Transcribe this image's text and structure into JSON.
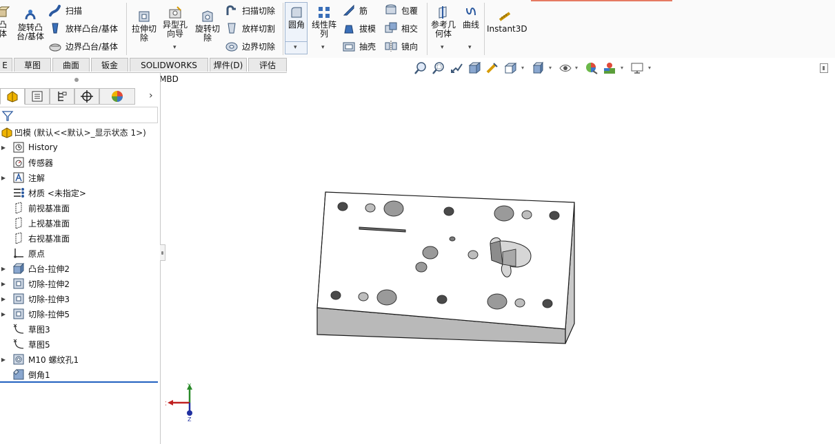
{
  "ribbon": {
    "features": {
      "extrude_boss": "凸\n体",
      "revolve_boss": "旋转凸\n台/基体",
      "sweep": "扫描",
      "loft": "放样凸台/基体",
      "boundary": "边界凸台/基体",
      "extrude_cut": "拉伸切\n除",
      "hole_wizard": "异型孔\n向导",
      "revolve_cut": "旋转切\n除",
      "sweep_cut": "扫描切除",
      "loft_cut": "放样切割",
      "boundary_cut": "边界切除",
      "fillet": "圆角",
      "linear_pattern": "线性阵\n列",
      "rib": "筋",
      "draft": "拔模",
      "shell": "抽壳",
      "wrap": "包覆",
      "intersect": "相交",
      "mirror": "镜向",
      "ref_geometry": "参考几\n何体",
      "curves": "曲线",
      "instant3d": "Instant3D"
    },
    "dropdown_glyph": "▾"
  },
  "tabs": [
    {
      "label": "E"
    },
    {
      "label": "草图"
    },
    {
      "label": "曲面"
    },
    {
      "label": "钣金"
    },
    {
      "label": "SOLIDWORKS MBD"
    },
    {
      "label": "焊件(D)"
    },
    {
      "label": "评估"
    }
  ],
  "tree": {
    "root": "凹模  (默认<<默认>_显示状态 1>)",
    "items": [
      {
        "label": "History",
        "icon": "history-icon",
        "expandable": true
      },
      {
        "label": "传感器",
        "icon": "sensor-icon",
        "expandable": false
      },
      {
        "label": "注解",
        "icon": "annotation-icon",
        "expandable": true
      },
      {
        "label": "材质 <未指定>",
        "icon": "material-icon",
        "expandable": false
      },
      {
        "label": "前视基准面",
        "icon": "plane-icon",
        "expandable": false
      },
      {
        "label": "上视基准面",
        "icon": "plane-icon",
        "expandable": false
      },
      {
        "label": "右视基准面",
        "icon": "plane-icon",
        "expandable": false
      },
      {
        "label": "原点",
        "icon": "origin-icon",
        "expandable": false
      },
      {
        "label": "凸台-拉伸2",
        "icon": "boss-extrude-icon",
        "expandable": true
      },
      {
        "label": "切除-拉伸2",
        "icon": "cut-extrude-icon",
        "expandable": true
      },
      {
        "label": "切除-拉伸3",
        "icon": "cut-extrude-icon",
        "expandable": true
      },
      {
        "label": "切除-拉伸5",
        "icon": "cut-extrude-icon",
        "expandable": true
      },
      {
        "label": "草图3",
        "icon": "sketch-icon",
        "expandable": false
      },
      {
        "label": "草图5",
        "icon": "sketch-icon",
        "expandable": false
      },
      {
        "label": "M10 螺纹孔1",
        "icon": "hole-icon",
        "expandable": true
      },
      {
        "label": "倒角1",
        "icon": "chamfer-icon",
        "expandable": false
      }
    ],
    "expand_glyph": "▶",
    "chevron": "›"
  },
  "triad": {
    "x": "X",
    "y": "Y",
    "z": "Z"
  },
  "colors": {
    "accent": "#1f5fbf",
    "part_face": "#ffffff",
    "part_side": "#b9b9b9",
    "hole": "#8a8a8a"
  }
}
